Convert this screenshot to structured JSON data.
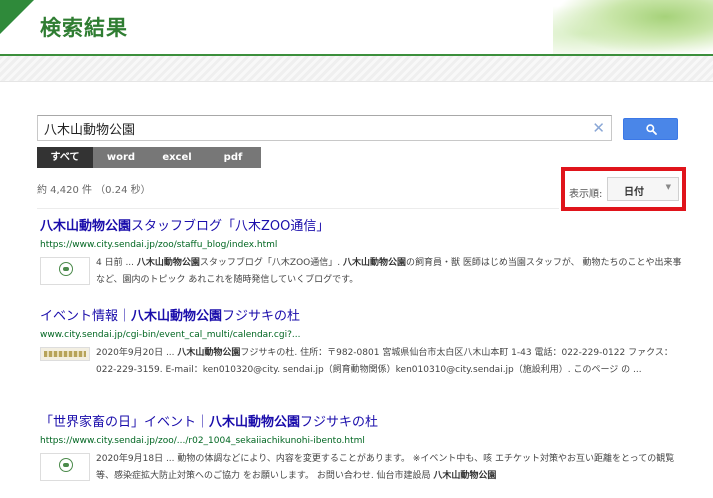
{
  "header": {
    "title": "検索結果"
  },
  "search": {
    "value": "八木山動物公園",
    "clear_glyph": "✕"
  },
  "tabs": [
    "すべて",
    "word",
    "excel",
    "pdf"
  ],
  "stats": {
    "text": "約 4,420 件 （0.24 秒）"
  },
  "sort": {
    "label": "表示順:",
    "selected": "日付",
    "caret": "▼"
  },
  "results": [
    {
      "title_pre": "",
      "title_bold": "八木山動物公園",
      "title_post": "スタッフブログ「八木ZOO通信」",
      "url": "https://www.city.sendai.jp/zoo/staffu_blog/index.html",
      "s1": "4 日前 ... ",
      "s2": "八木山動物公園",
      "s3": "スタッフブログ「八木ZOO通信」. ",
      "s4": "八木山動物公園",
      "s5": "の飼育員・獣 医師はじめ当園スタッフが、 動物たちのことや出来事など、園内のトピック あれこれを随時発信していくブログです。"
    },
    {
      "title_pre": "イベント情報｜",
      "title_bold": "八木山動物公園",
      "title_post": "フジサキの杜",
      "url": "www.city.sendai.jp/cgi-bin/event_cal_multi/calendar.cgi?...",
      "s1": "2020年9月20日 ... ",
      "s2": "八木山動物公園",
      "s3": "フジサキの杜. 住所：〒982-0801 宮城県仙台市太白区八木山本町 1-43 電話：022-229-0122 ファクス：022-229-3159. E-mail：ken010320@city. sendai.jp（飼育動物関係）ken010310@city.sendai.jp（施設利用）. このページ の ...",
      "s4": "",
      "s5": ""
    },
    {
      "title_pre": "「世界家畜の日」イベント｜",
      "title_bold": "八木山動物公園",
      "title_post": "フジサキの杜",
      "url": "https://www.city.sendai.jp/zoo/.../r02_1004_sekaiiachikunohi-ibento.html",
      "s1": "2020年9月18日 ... 動物の体調などにより、内容を変更することがあります。 ※イベント中も、咳 エチケット対策やお互い距離をとっての観覧等、感染症拡大防止対策へのご協力 をお願いします。 お問い合わせ. 仙台市建設局 ",
      "s2": "八木山動物公園",
      "s3": "",
      "s4": "",
      "s5": ""
    }
  ]
}
